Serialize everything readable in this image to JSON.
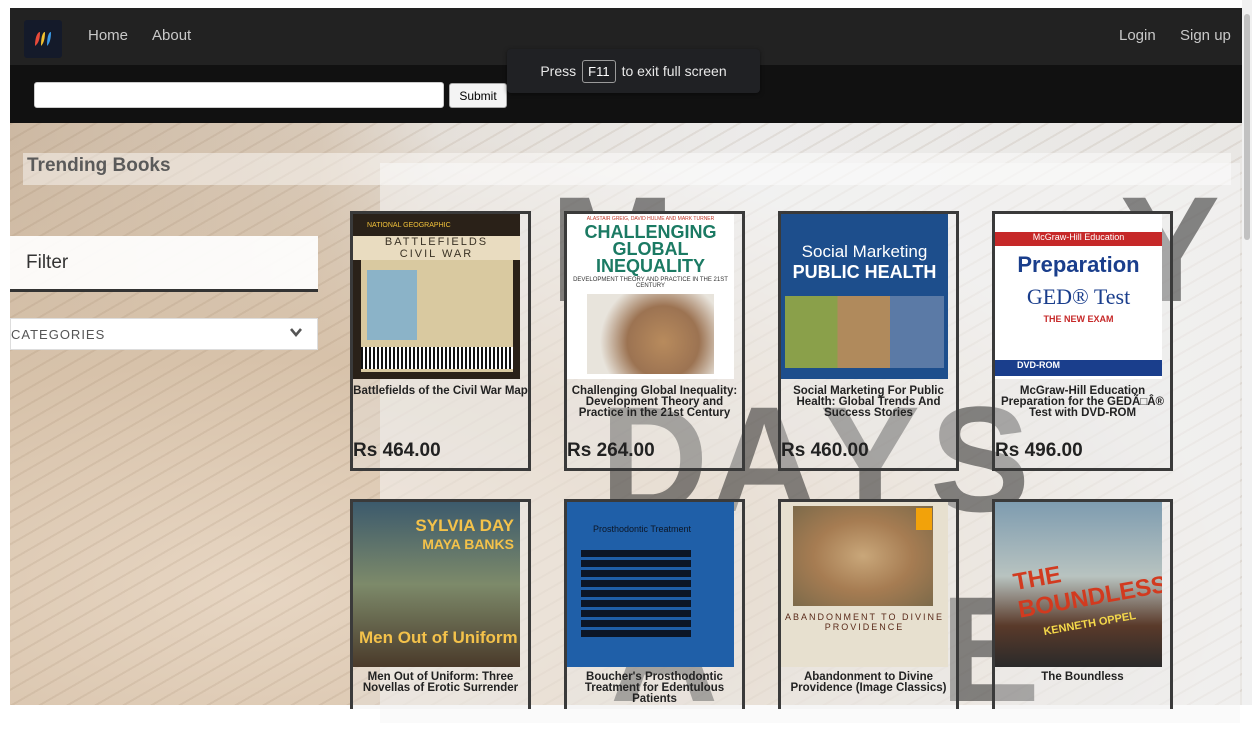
{
  "navbar": {
    "logo": "app-logo-icon",
    "links": {
      "home": "Home",
      "about": "About",
      "login": "Login",
      "signup": "Sign up"
    }
  },
  "search": {
    "value": "",
    "placeholder": "",
    "submit_label": "Submit"
  },
  "fullscreen_toast": {
    "prefix": "Press",
    "key": "F11",
    "suffix": "to exit full screen"
  },
  "trending": {
    "title": "Trending Books"
  },
  "filter": {
    "title": "Filter",
    "categories_label": "CATEGORIES",
    "categories_icon": "chevron-down-icon"
  },
  "hero_letters": [
    "M",
    "Y",
    "D",
    "A",
    "Y",
    "S",
    "A",
    "E"
  ],
  "books": [
    {
      "title": "Battlefields of the Civil War Map",
      "price": "Rs 464.00"
    },
    {
      "title": "Challenging Global Inequality: Development Theory and Practice in the 21st Century",
      "price": "Rs 264.00"
    },
    {
      "title": "Social Marketing For Public Health: Global Trends And Success Stories",
      "price": "Rs 460.00"
    },
    {
      "title": "McGraw-Hill Education Preparation for the GEDÃ□Â® Test with DVD-ROM",
      "price": "Rs 496.00"
    },
    {
      "title": "Men Out of Uniform: Three Novellas of Erotic Surrender",
      "price": ""
    },
    {
      "title": "Boucher's Prosthodontic Treatment for Edentulous Patients",
      "price": ""
    },
    {
      "title": "Abandonment to Divine Providence (Image Classics)",
      "price": ""
    },
    {
      "title": "The Boundless",
      "price": ""
    }
  ],
  "covers": {
    "ng_brand": "NATIONAL GEOGRAPHIC",
    "ng_title_1": "BATTLEFIELDS",
    "ng_title_2": "CIVIL WAR",
    "cgi_authors": "ALASTAIR GREIG, DAVID HULME AND MARK TURNER",
    "cgi_title": "CHALLENGING GLOBAL INEQUALITY",
    "cgi_sub": "DEVELOPMENT THEORY AND PRACTICE IN THE 21ST CENTURY",
    "smph_t1": "Social Marketing",
    "smph_t2": "PUBLIC HEALTH",
    "ged_brand": "McGraw-Hill Education",
    "ged_title": "Preparation",
    "ged_test": "GED® Test",
    "ged_new": "THE NEW EXAM",
    "ged_dvd": "DVD-ROM",
    "mou_author1": "SYLVIA DAY",
    "mou_author2": "MAYA BANKS",
    "mou_title": "Men Out of Uniform",
    "bpt_title": "Prosthodontic Treatment",
    "adp_title": "ABANDONMENT TO DIVINE PROVIDENCE",
    "tbo_title": "THE BOUNDLESS",
    "tbo_author": "KENNETH OPPEL"
  },
  "colors": {
    "navbar": "#222222",
    "search_strip": "#111111",
    "accent_text": "#c9c9c9"
  }
}
